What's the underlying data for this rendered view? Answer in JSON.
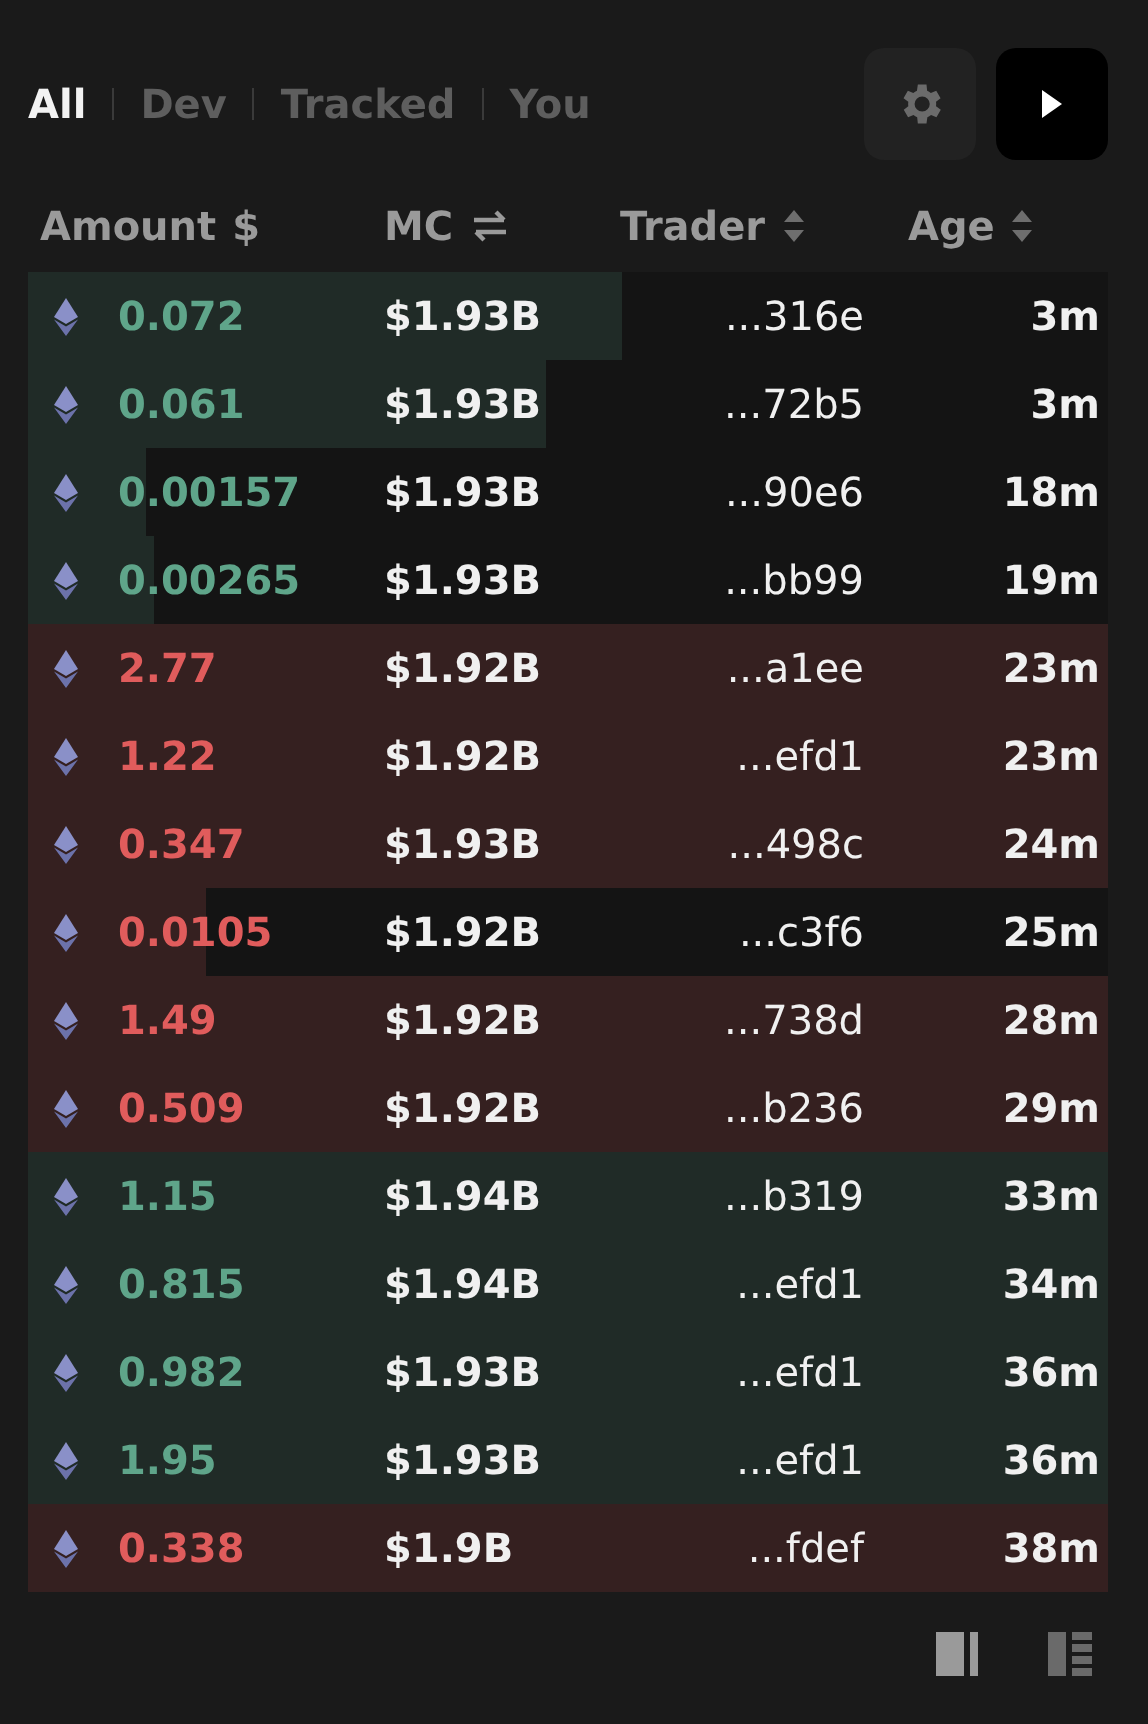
{
  "tabs": [
    {
      "label": "All",
      "selected": true
    },
    {
      "label": "Dev",
      "selected": false
    },
    {
      "label": "Tracked",
      "selected": false
    },
    {
      "label": "You",
      "selected": false
    }
  ],
  "columns": [
    {
      "label": "Amount",
      "kind": "currency",
      "symbol": "$"
    },
    {
      "label": "MC",
      "kind": "swap"
    },
    {
      "label": "Trader",
      "kind": "sort"
    },
    {
      "label": "Age",
      "kind": "sort"
    }
  ],
  "rows": [
    {
      "color": "#5fa58a",
      "level": 0.55,
      "amount": "0.072",
      "mc": "$1.93B",
      "trader": "...316e",
      "age": "3m"
    },
    {
      "color": "#5fa58a",
      "level": 0.48,
      "amount": "0.061",
      "mc": "$1.93B",
      "trader": "...72b5",
      "age": "3m"
    },
    {
      "color": "#5fa58a",
      "level": 0.11,
      "amount": "0.00157",
      "mc": "$1.93B",
      "trader": "...90e6",
      "age": "18m"
    },
    {
      "color": "#5fa58a",
      "level": 0.117,
      "amount": "0.00265",
      "mc": "$1.93B",
      "trader": "...bb99",
      "age": "19m"
    },
    {
      "color": "#e05c5c",
      "level": 1,
      "amount": "2.77",
      "mc": "$1.92B",
      "trader": "...a1ee",
      "age": "23m"
    },
    {
      "color": "#e05c5c",
      "level": 1,
      "amount": "1.22",
      "mc": "$1.92B",
      "trader": "...efd1",
      "age": "23m"
    },
    {
      "color": "#e05c5c",
      "level": 1,
      "amount": "0.347",
      "mc": "$1.93B",
      "trader": "...498c",
      "age": "24m"
    },
    {
      "color": "#e05c5c",
      "level": 0.165,
      "amount": "0.0105",
      "mc": "$1.92B",
      "trader": "...c3f6",
      "age": "25m"
    },
    {
      "color": "#e05c5c",
      "level": 1,
      "amount": "1.49",
      "mc": "$1.92B",
      "trader": "...738d",
      "age": "28m"
    },
    {
      "color": "#e05c5c",
      "level": 1,
      "amount": "0.509",
      "mc": "$1.92B",
      "trader": "...b236",
      "age": "29m"
    },
    {
      "color": "#5fa58a",
      "level": 1,
      "amount": "1.15",
      "mc": "$1.94B",
      "trader": "...b319",
      "age": "33m"
    },
    {
      "color": "#5fa58a",
      "level": 1,
      "amount": "0.815",
      "mc": "$1.94B",
      "trader": "...efd1",
      "age": "34m"
    },
    {
      "color": "#5fa58a",
      "level": 1,
      "amount": "0.982",
      "mc": "$1.93B",
      "trader": "...efd1",
      "age": "36m"
    },
    {
      "color": "#5fa58a",
      "level": 1,
      "amount": "1.95",
      "mc": "$1.93B",
      "trader": "...efd1",
      "age": "36m"
    },
    {
      "color": "#e05c5c",
      "level": 1,
      "amount": "0.338",
      "mc": "$1.9B",
      "trader": "...fdef",
      "age": "38m"
    }
  ]
}
